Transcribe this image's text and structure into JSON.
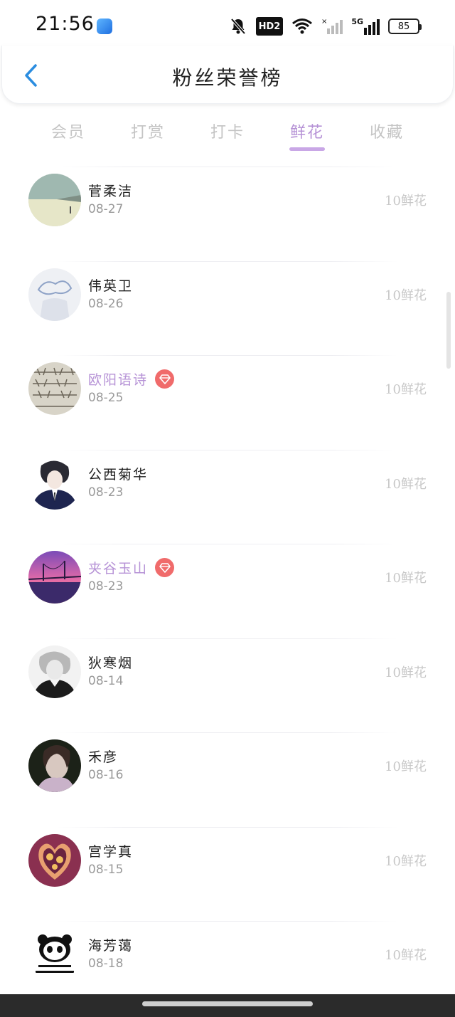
{
  "status_bar": {
    "time": "21:56",
    "hd_label": "HD2",
    "network_label": "5G",
    "battery": "85"
  },
  "header": {
    "title": "粉丝荣誉榜"
  },
  "tabs": [
    {
      "label": "会员"
    },
    {
      "label": "打赏"
    },
    {
      "label": "打卡"
    },
    {
      "label": "鲜花"
    },
    {
      "label": "收藏"
    }
  ],
  "active_tab": "鲜花",
  "colors": {
    "accent": "#b692d6",
    "vip_badge": "#f06b6b",
    "back_arrow": "#2b8de0"
  },
  "fans": [
    {
      "name": "菅柔洁",
      "date": "08-27",
      "amount": "10鲜花",
      "vip": false
    },
    {
      "name": "伟英卫",
      "date": "08-26",
      "amount": "10鲜花",
      "vip": false
    },
    {
      "name": "欧阳语诗",
      "date": "08-25",
      "amount": "10鲜花",
      "vip": true
    },
    {
      "name": "公西菊华",
      "date": "08-23",
      "amount": "10鲜花",
      "vip": false
    },
    {
      "name": "夹谷玉山",
      "date": "08-23",
      "amount": "10鲜花",
      "vip": true
    },
    {
      "name": "狄寒烟",
      "date": "08-14",
      "amount": "10鲜花",
      "vip": false
    },
    {
      "name": "禾彦",
      "date": "08-16",
      "amount": "10鲜花",
      "vip": false
    },
    {
      "name": "宫学真",
      "date": "08-15",
      "amount": "10鲜花",
      "vip": false
    },
    {
      "name": "海芳蔼",
      "date": "08-18",
      "amount": "10鲜花",
      "vip": false
    }
  ]
}
